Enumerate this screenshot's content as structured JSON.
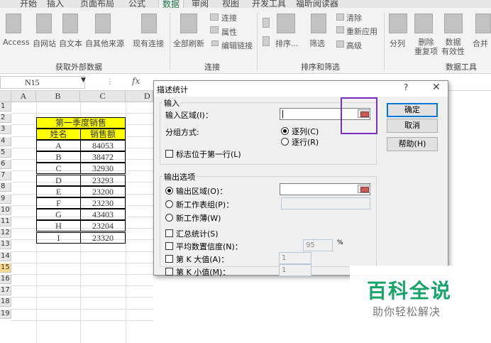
{
  "ribbon": {
    "tabs": [
      "开始",
      "插入",
      "页面布局",
      "公式",
      "数据",
      "审阅",
      "视图",
      "开发工具",
      "福昕阅读器"
    ],
    "active_tab": "数据",
    "get_external": {
      "access": "Access",
      "web": "自网站",
      "text": "自文本",
      "other": "自其他来源",
      "existing": "现有连接",
      "group": "获取外部数据"
    },
    "connections": {
      "refresh": "全部刷新",
      "connections": "连接",
      "properties": "属性",
      "edit_links": "编辑链接",
      "group": "连接"
    },
    "sort_filter": {
      "sort": "排序...",
      "filter": "筛选",
      "clear": "清除",
      "reapply": "重新应用",
      "advanced": "高级",
      "group": "排序和筛选"
    },
    "data_tools": {
      "split": "分列",
      "remove_dup": "删除\n重复项",
      "validation": "数据\n有效性",
      "consolidate": "合并",
      "group": "数据工具"
    }
  },
  "formula_bar": {
    "name_box": "N15",
    "fx": "fx"
  },
  "sheet": {
    "columns": [
      "A",
      "B",
      "C",
      "D"
    ],
    "rows": [
      "1",
      "2",
      "3",
      "4",
      "5",
      "6",
      "7",
      "8",
      "9",
      "10",
      "11",
      "12",
      "13",
      "14",
      "15",
      "16",
      "17",
      "18",
      "19"
    ],
    "selected_row": "15",
    "table_title": "第一季度销售",
    "header_name": "姓名",
    "header_sales": "销售额",
    "data": [
      {
        "name": "A",
        "sales": "84053"
      },
      {
        "name": "B",
        "sales": "38472"
      },
      {
        "name": "C",
        "sales": "32930"
      },
      {
        "name": "D",
        "sales": "23293"
      },
      {
        "name": "E",
        "sales": "23200"
      },
      {
        "name": "F",
        "sales": "23230"
      },
      {
        "name": "G",
        "sales": "43403"
      },
      {
        "name": "H",
        "sales": "23204"
      },
      {
        "name": "I",
        "sales": "23320"
      }
    ]
  },
  "dialog": {
    "title": "描述统计",
    "help": "?",
    "close": "✕",
    "input_section": "输入",
    "input_range": "输入区域(I)：",
    "group_by": "分组方式:",
    "by_column": "逐列(C)",
    "by_row": "逐行(R)",
    "labels_first_row": "标志位于第一行(L)",
    "output_section": "输出选项",
    "output_range": "输出区域(O)：",
    "new_worksheet": "新工作表组(P)：",
    "new_workbook": "新工作薄(W)",
    "summary_stats": "汇总统计(S)",
    "confidence": "平均数置信度(N)：",
    "confidence_value": "95",
    "percent": "%",
    "kth_largest": "第 K 大值(A)：",
    "kth_largest_value": "1",
    "kth_smallest": "第 K 小值(M)：",
    "kth_smallest_value": "1",
    "ok": "确定",
    "cancel": "取消",
    "help_button": "帮助(H)"
  },
  "watermark": {
    "title": "百科全说",
    "subtitle": "助你轻松解决"
  }
}
